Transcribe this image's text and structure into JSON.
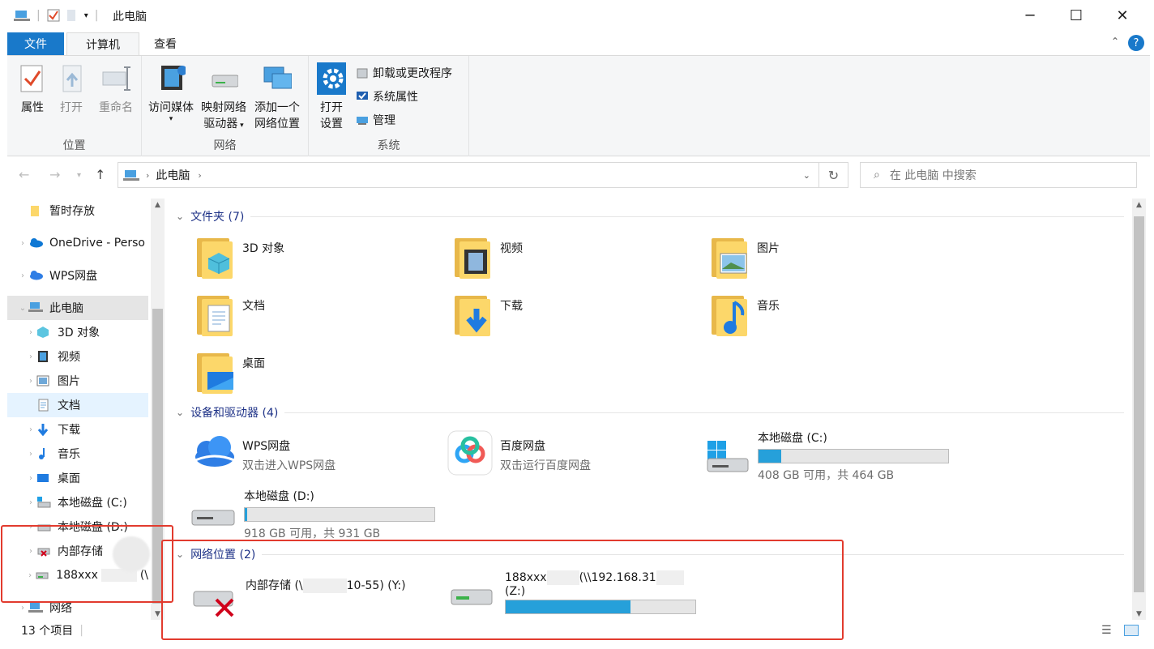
{
  "window": {
    "title": "此电脑",
    "minimize_glyph": "─",
    "maximize_glyph": "☐",
    "close_glyph": "✕"
  },
  "tabs": {
    "file": "文件",
    "computer": "计算机",
    "view": "查看"
  },
  "ribbon": {
    "location_group": {
      "label": "位置",
      "properties": "属性",
      "open": "打开",
      "rename": "重命名"
    },
    "network_group": {
      "label": "网络",
      "access_media": "访问媒体",
      "map_drive_1": "映射网络",
      "map_drive_2": "驱动器",
      "add_location_1": "添加一个",
      "add_location_2": "网络位置"
    },
    "system_group": {
      "label": "系统",
      "open_settings_1": "打开",
      "open_settings_2": "设置",
      "uninstall": "卸载或更改程序",
      "system_props": "系统属性",
      "manage": "管理"
    }
  },
  "address": {
    "path": "此电脑",
    "search_placeholder": "在 此电脑 中搜索"
  },
  "nav": {
    "items": [
      {
        "label": "暂时存放"
      },
      {
        "label": "OneDrive - Perso"
      },
      {
        "label": "WPS网盘"
      },
      {
        "label": "此电脑"
      },
      {
        "label": "3D 对象"
      },
      {
        "label": "视频"
      },
      {
        "label": "图片"
      },
      {
        "label": "文档"
      },
      {
        "label": "下载"
      },
      {
        "label": "音乐"
      },
      {
        "label": "桌面"
      },
      {
        "label": "本地磁盘 (C:)"
      },
      {
        "label": "本地磁盘 (D:)"
      },
      {
        "label": "内部存储"
      },
      {
        "label": "188xxx"
      },
      {
        "label": "网络"
      }
    ],
    "trailing_188": "(\\"
  },
  "sections": {
    "folders": "文件夹 (7)",
    "devices": "设备和驱动器 (4)",
    "network": "网络位置 (2)"
  },
  "folders": [
    {
      "name": "3D 对象"
    },
    {
      "name": "视频"
    },
    {
      "name": "图片"
    },
    {
      "name": "文档"
    },
    {
      "name": "下载"
    },
    {
      "name": "音乐"
    },
    {
      "name": "桌面"
    }
  ],
  "devices": {
    "wps": {
      "name": "WPS网盘",
      "sub": "双击进入WPS网盘"
    },
    "baidu": {
      "name": "百度网盘",
      "sub": "双击运行百度网盘"
    },
    "c": {
      "name": "本地磁盘 (C:)",
      "sub": "408 GB 可用，共 464 GB",
      "used_fraction": 0.12
    },
    "d": {
      "name": "本地磁盘 (D:)",
      "sub": "918 GB 可用，共 931 GB",
      "used_fraction": 0.014
    }
  },
  "network_locations": {
    "y": {
      "name_a": "内部存储 (\\",
      "name_b": "10-55) (Y:)"
    },
    "z": {
      "name_a": "188xxx",
      "name_b": "(\\\\192.168.31",
      "name_c": "(Z:)",
      "used_fraction": 0.66
    }
  },
  "status": {
    "count": "13 个项目"
  },
  "colors": {
    "accent": "#1979ca",
    "folder": "#fcd76a",
    "bar": "#26a0da",
    "highlight": "#e23b2e"
  }
}
